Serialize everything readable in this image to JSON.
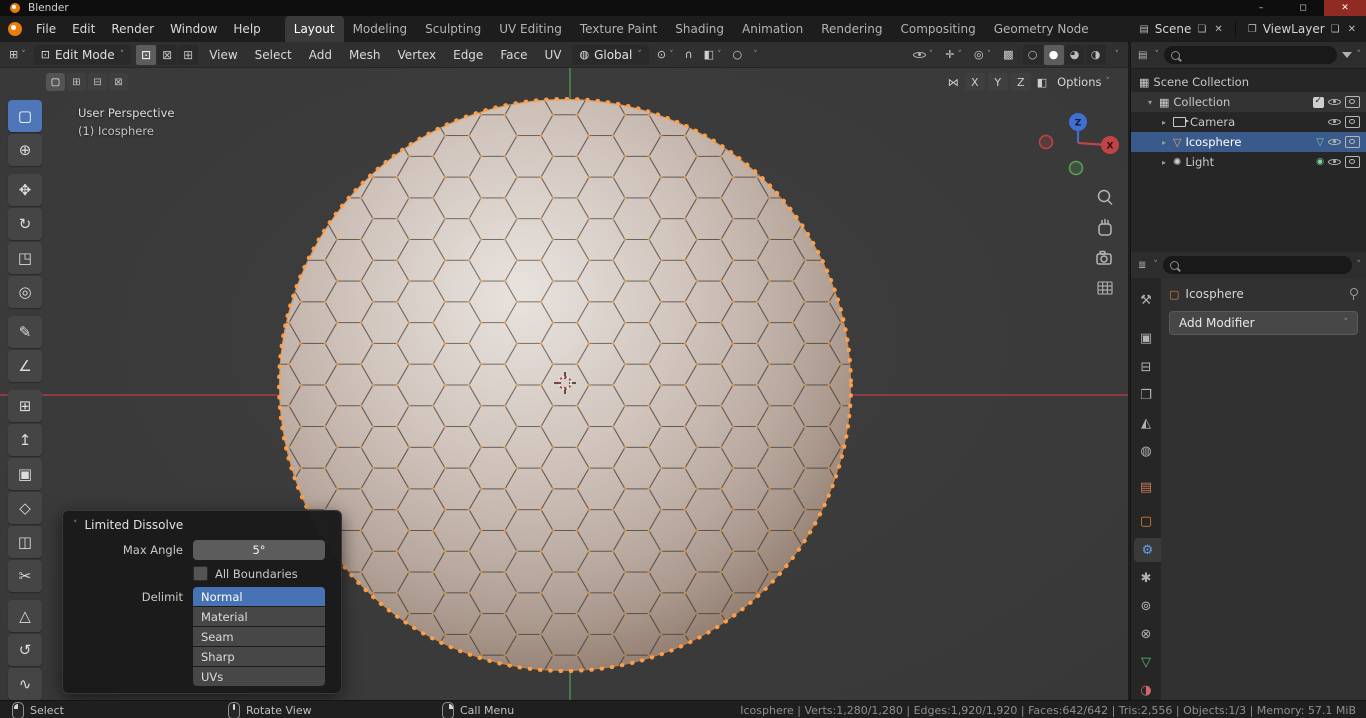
{
  "window": {
    "title": "Blender",
    "controls": {
      "minimize": "–",
      "maximize": "◻",
      "close": "✕"
    }
  },
  "menubar": {
    "menus": [
      {
        "label": "File"
      },
      {
        "label": "Edit"
      },
      {
        "label": "Render"
      },
      {
        "label": "Window"
      },
      {
        "label": "Help"
      }
    ],
    "workspaces": [
      {
        "label": "Layout",
        "active": true
      },
      {
        "label": "Modeling"
      },
      {
        "label": "Sculpting"
      },
      {
        "label": "UV Editing"
      },
      {
        "label": "Texture Paint"
      },
      {
        "label": "Shading"
      },
      {
        "label": "Animation"
      },
      {
        "label": "Rendering"
      },
      {
        "label": "Compositing"
      },
      {
        "label": "Geometry Node"
      }
    ],
    "scene": {
      "label": "Scene"
    },
    "view_layer": {
      "label": "ViewLayer"
    }
  },
  "viewport": {
    "header": {
      "mode": "Edit Mode",
      "menus": [
        {
          "label": "View"
        },
        {
          "label": "Select"
        },
        {
          "label": "Add"
        },
        {
          "label": "Mesh"
        },
        {
          "label": "Vertex"
        },
        {
          "label": "Edge"
        },
        {
          "label": "Face"
        },
        {
          "label": "UV"
        }
      ],
      "orientation": "Global"
    },
    "tool_settings": {
      "axes": [
        {
          "label": "X"
        },
        {
          "label": "Y"
        },
        {
          "label": "Z"
        }
      ],
      "options_label": "Options"
    },
    "overlay": {
      "line1": "User Perspective",
      "line2": "(1) Icosphere"
    },
    "gizmo": {
      "z_label": "Z",
      "x_label": "X"
    }
  },
  "toolbar": {
    "tools": [
      {
        "name": "tweak-select",
        "glyph": "▢",
        "active": true
      },
      {
        "name": "cursor",
        "glyph": "⊕"
      },
      {
        "name": "move",
        "glyph": "✥"
      },
      {
        "name": "rotate",
        "glyph": "↻"
      },
      {
        "name": "scale",
        "glyph": "◳"
      },
      {
        "name": "transform",
        "glyph": "◎"
      },
      {
        "name": "annotate",
        "glyph": "✎"
      },
      {
        "name": "measure",
        "glyph": "∠"
      },
      {
        "name": "add-cube",
        "glyph": "⊞"
      },
      {
        "name": "extrude-region",
        "glyph": "↥"
      },
      {
        "name": "inset-faces",
        "glyph": "▣"
      },
      {
        "name": "bevel",
        "glyph": "◇"
      },
      {
        "name": "loop-cut",
        "glyph": "◫"
      },
      {
        "name": "knife",
        "glyph": "✂"
      },
      {
        "name": "poly-build",
        "glyph": "△"
      },
      {
        "name": "spin",
        "glyph": "↺"
      },
      {
        "name": "smooth",
        "glyph": "∿"
      }
    ]
  },
  "operator_panel": {
    "title": "Limited Dissolve",
    "max_angle_label": "Max Angle",
    "max_angle_value": "5°",
    "all_boundaries_label": "All Boundaries",
    "delimit_label": "Delimit",
    "delimit_options": [
      {
        "label": "Normal",
        "selected": true
      },
      {
        "label": "Material"
      },
      {
        "label": "Seam"
      },
      {
        "label": "Sharp"
      },
      {
        "label": "UVs"
      }
    ]
  },
  "outliner": {
    "items": [
      {
        "label": "Scene Collection"
      },
      {
        "label": "Collection"
      },
      {
        "label": "Camera"
      },
      {
        "label": "Icosphere",
        "selected": true
      },
      {
        "label": "Light"
      }
    ]
  },
  "properties": {
    "breadcrumb": "Icosphere",
    "add_modifier_label": "Add Modifier",
    "tabs": [
      {
        "name": "tool",
        "glyph": "⚒"
      },
      {
        "name": "render",
        "glyph": "▣"
      },
      {
        "name": "output",
        "glyph": "⊟"
      },
      {
        "name": "view-layer",
        "glyph": "❐"
      },
      {
        "name": "scene",
        "glyph": "◭"
      },
      {
        "name": "world",
        "glyph": "◍"
      },
      {
        "name": "collection",
        "glyph": "▤"
      },
      {
        "name": "object",
        "glyph": "▢"
      },
      {
        "name": "modifiers",
        "glyph": "⚙",
        "active": true
      },
      {
        "name": "particles",
        "glyph": "✱"
      },
      {
        "name": "physics",
        "glyph": "⊚"
      },
      {
        "name": "constraints",
        "glyph": "⊗"
      },
      {
        "name": "object-data",
        "glyph": "▽"
      },
      {
        "name": "material",
        "glyph": "◑"
      }
    ]
  },
  "status_bar": {
    "hints": [
      {
        "label": "Select"
      },
      {
        "label": "Rotate View"
      },
      {
        "label": "Call Menu"
      }
    ],
    "stats": "Icosphere | Verts:1,280/1,280 | Edges:1,920/1,920 | Faces:642/642 | Tris:2,556 | Objects:1/3 | Memory: 57.1 MiB"
  },
  "colors": {
    "accent": "#4772b3",
    "selection_orange": "#ff9d45",
    "axis_x": "#b84242",
    "axis_y": "#4f9a50",
    "axis_z": "#3f6fd0"
  }
}
